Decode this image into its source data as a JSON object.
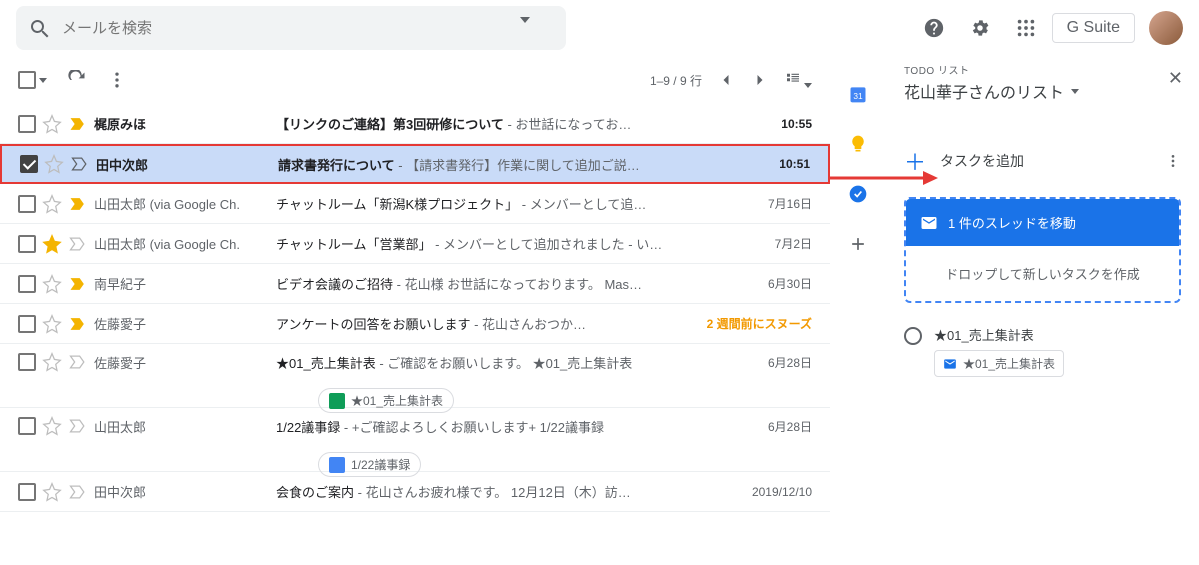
{
  "search": {
    "placeholder": "メールを検索"
  },
  "topbar": {
    "gsuite": "G Suite"
  },
  "toolbar": {
    "range": "1–9 / 9 行"
  },
  "rows": [
    {
      "sender": "梶原みほ",
      "subject": "【リンクのご連絡】第3回研修について",
      "snippet": " - お世話になってお…",
      "date": "10:55"
    },
    {
      "sender": "田中次郎",
      "subject": "請求書発行について",
      "snippet": " - 【請求書発行】作業に関して追加ご説…",
      "date": "10:51"
    },
    {
      "sender": "山田太郎 (via Google Ch.",
      "subject": "チャットルーム「新潟K様プロジェクト」",
      "snippet": " - メンバーとして追…",
      "date": "7月16日"
    },
    {
      "sender": "山田太郎 (via Google Ch.",
      "subject": "チャットルーム「営業部」",
      "snippet": " - メンバーとして追加されました - い…",
      "date": "7月2日"
    },
    {
      "sender": "南早紀子",
      "subject": "ビデオ会議のご招待",
      "snippet": " - 花山様 お世話になっております。 Mas…",
      "date": "6月30日"
    },
    {
      "sender": "佐藤愛子",
      "subject": "アンケートの回答をお願いします",
      "snippet": " - 花山さんおつか…",
      "date": "",
      "snooze": "2 週間前にスヌーズ"
    },
    {
      "sender": "佐藤愛子",
      "subject": "★01_売上集計表",
      "snippet": " - ご確認をお願いします。 ★01_売上集計表",
      "date": "6月28日",
      "chip": "★01_売上集計表"
    },
    {
      "sender": "山田太郎",
      "subject": "1/22議事録",
      "snippet": " - +ご確認よろしくお願いします+ 1/22議事録",
      "date": "6月28日",
      "chip": "1/22議事録"
    },
    {
      "sender": "田中次郎",
      "subject": "会食のご案内",
      "snippet": " - 花山さんお疲れ様です。 12月12日（木）訪…",
      "date": "2019/12/10"
    }
  ],
  "tasks": {
    "header_small": "TODO リスト",
    "list_name": "花山華子さんのリスト",
    "add_label": "タスクを追加",
    "drop_banner": "1 件のスレッドを移動",
    "drop_body": "ドロップして新しいタスクを作成",
    "item1_title": "★01_売上集計表",
    "item1_chip": "★01_売上集計表"
  }
}
